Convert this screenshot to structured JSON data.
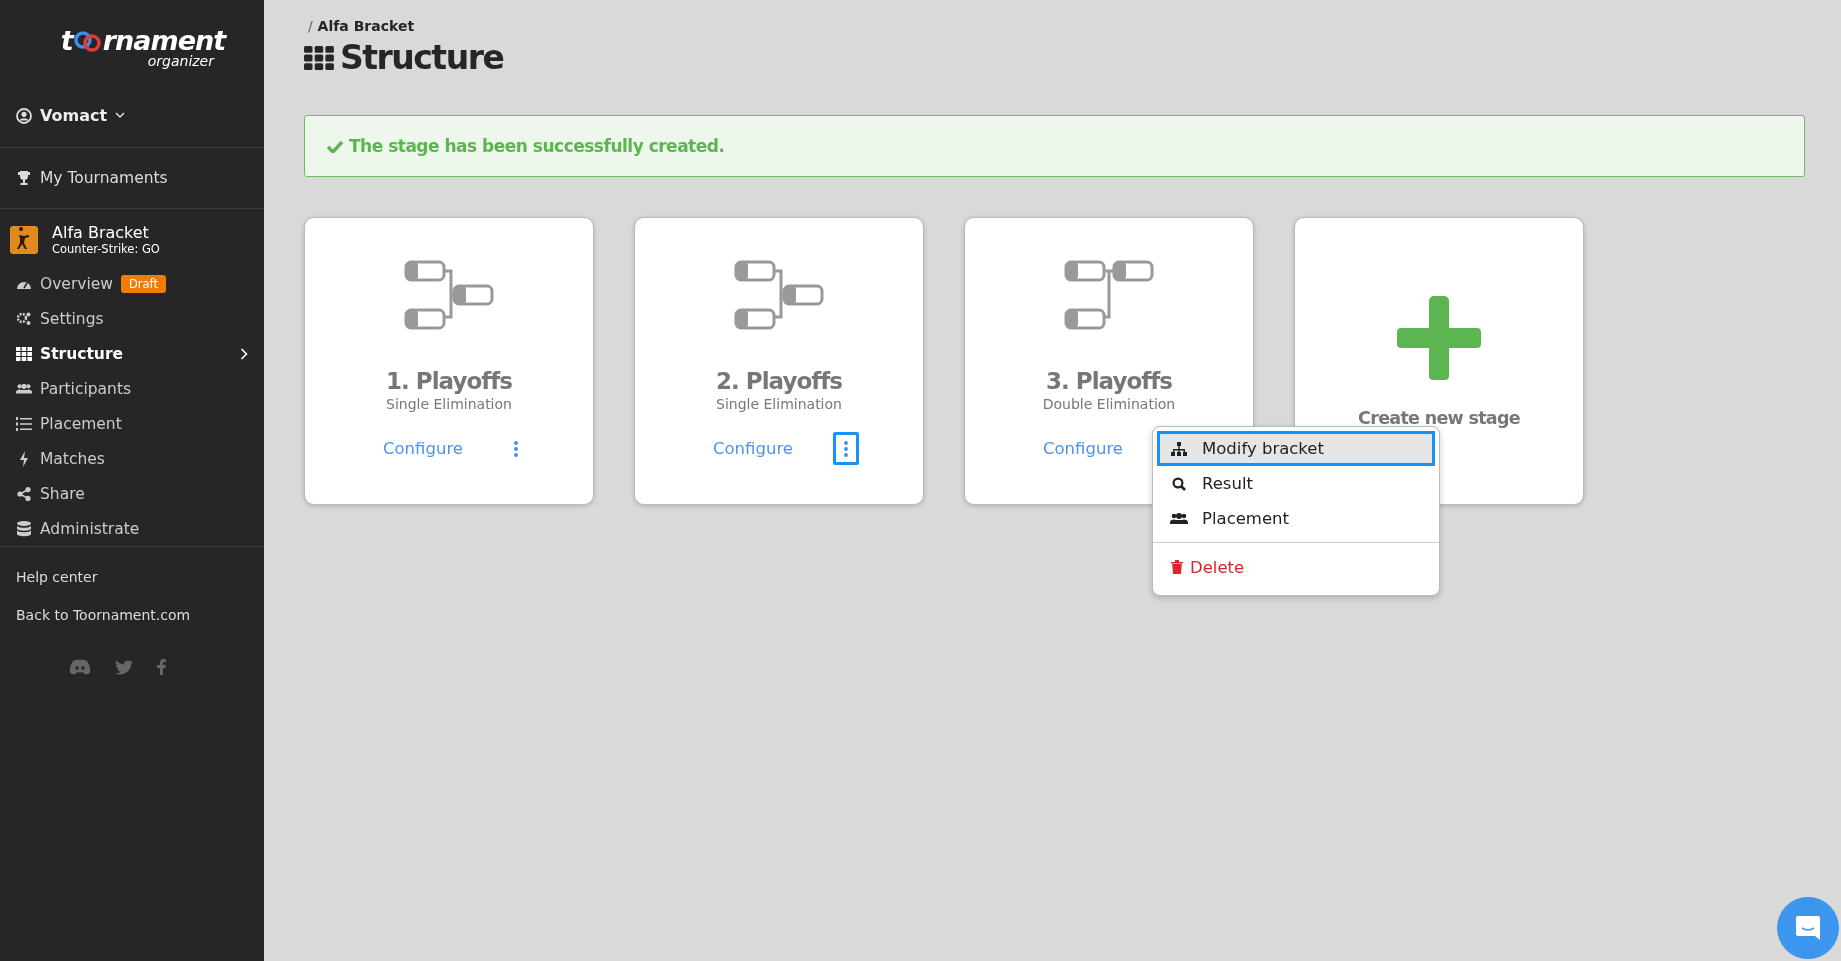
{
  "sidebar": {
    "logo": {
      "before": "t",
      "after": "rnament",
      "subtitle": "organizer"
    },
    "user": {
      "name": "Vomact"
    },
    "my_tournaments": "My Tournaments",
    "tournament": {
      "name": "Alfa Bracket",
      "game": "Counter-Strike: GO"
    },
    "items": [
      {
        "label": "Overview",
        "badge": "Draft",
        "selected": false
      },
      {
        "label": "Settings",
        "selected": false
      },
      {
        "label": "Structure",
        "selected": true
      },
      {
        "label": "Participants",
        "selected": false
      },
      {
        "label": "Placement",
        "selected": false
      },
      {
        "label": "Matches",
        "selected": false
      },
      {
        "label": "Share",
        "selected": false
      },
      {
        "label": "Administrate",
        "selected": false
      }
    ],
    "links": [
      "Help center",
      "Back to Toornament.com"
    ]
  },
  "breadcrumb": {
    "separator": "/",
    "label": "Alfa Bracket"
  },
  "title": "Structure",
  "alert": "The stage has been successfully created.",
  "cards": [
    {
      "kind": "stage",
      "double": false,
      "title": "1. Playoffs",
      "subtitle": "Single Elimination",
      "action": "Configure",
      "menu_button": {
        "focused": false
      }
    },
    {
      "kind": "stage",
      "double": false,
      "title": "2. Playoffs",
      "subtitle": "Single Elimination",
      "action": "Configure",
      "menu_button": {
        "focused": true
      }
    },
    {
      "kind": "stage",
      "double": true,
      "title": "3. Playoffs",
      "subtitle": "Double Elimination",
      "action": "Configure",
      "menu": [
        {
          "label": "Modify bracket",
          "kind": "normal",
          "selected": true
        },
        {
          "label": "Result",
          "kind": "normal",
          "selected": false
        },
        {
          "label": "Placement",
          "kind": "normal",
          "selected": false
        },
        {
          "label": "Delete",
          "kind": "danger",
          "selected": false
        }
      ]
    },
    {
      "kind": "create",
      "title": "Create new stage"
    }
  ]
}
